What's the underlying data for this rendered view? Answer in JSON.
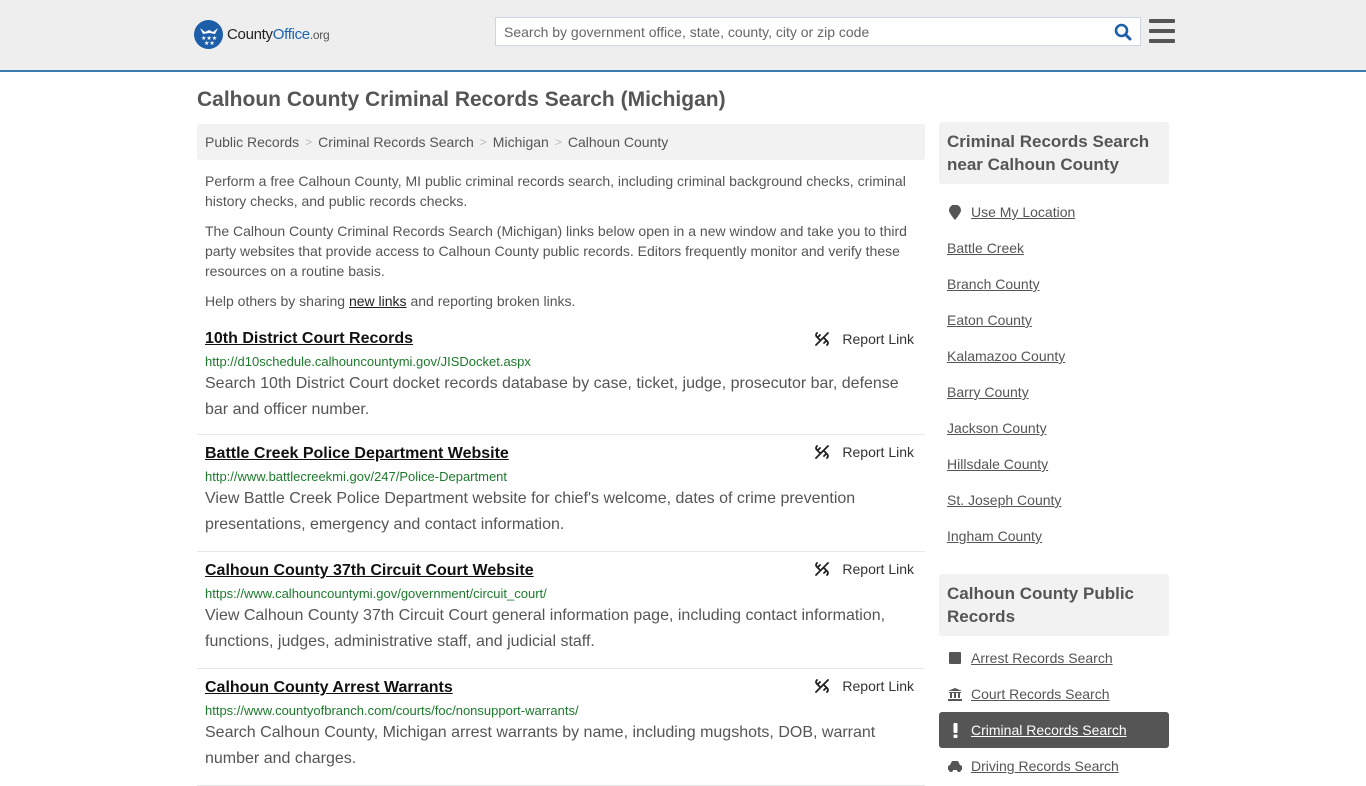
{
  "header": {
    "logo": {
      "county": "County",
      "office": "Office",
      "org": ".org"
    },
    "search": {
      "placeholder": "Search by government office, state, county, city or zip code",
      "value": ""
    },
    "search_icon": "search-icon",
    "menu_icon": "hamburger-menu-icon"
  },
  "page": {
    "title": "Calhoun County Criminal Records Search (Michigan)",
    "breadcrumb": [
      "Public Records",
      "Criminal Records Search",
      "Michigan",
      "Calhoun County"
    ],
    "breadcrumb_separator": ">",
    "intro": {
      "p1": "Perform a free Calhoun County, MI public criminal records search, including criminal background checks, criminal history checks, and public records checks.",
      "p2": "The Calhoun County Criminal Records Search (Michigan) links below open in a new window and take you to third party websites that provide access to Calhoun County public records. Editors frequently monitor and verify these resources on a routine basis.",
      "p3_before": "Help others by sharing ",
      "p3_link": "new links",
      "p3_after": " and reporting broken links."
    },
    "report_label": "Report Link",
    "results": [
      {
        "title": "10th District Court Records",
        "url": "http://d10schedule.calhouncountymi.gov/JISDocket.aspx",
        "description": "Search 10th District Court docket records database by case, ticket, judge, prosecutor bar, defense bar and officer number."
      },
      {
        "title": "Battle Creek Police Department Website",
        "url": "http://www.battlecreekmi.gov/247/Police-Department",
        "description": "View Battle Creek Police Department website for chief's welcome, dates of crime prevention presentations, emergency and contact information."
      },
      {
        "title": "Calhoun County 37th Circuit Court Website",
        "url": "https://www.calhouncountymi.gov/government/circuit_court/",
        "description": "View Calhoun County 37th Circuit Court general information page, including contact information, functions, judges, administrative staff, and judicial staff."
      },
      {
        "title": "Calhoun County Arrest Warrants",
        "url": "https://www.countyofbranch.com/courts/foc/nonsupport-warrants/",
        "description": "Search Calhoun County, Michigan arrest warrants by name, including mugshots, DOB, warrant number and charges."
      }
    ]
  },
  "sidebar": {
    "nearby": {
      "heading": "Criminal Records Search near Calhoun County",
      "use_location": "Use My Location",
      "items": [
        "Battle Creek",
        "Branch County",
        "Eaton County",
        "Kalamazoo County",
        "Barry County",
        "Jackson County",
        "Hillsdale County",
        "St. Joseph County",
        "Ingham County"
      ]
    },
    "public_records": {
      "heading": "Calhoun County Public Records",
      "items": [
        {
          "label": "Arrest Records Search",
          "icon": "square-icon",
          "active": false
        },
        {
          "label": "Court Records Search",
          "icon": "courthouse-icon",
          "active": false
        },
        {
          "label": "Criminal Records Search",
          "icon": "exclamation-icon",
          "active": true
        },
        {
          "label": "Driving Records Search",
          "icon": "car-icon",
          "active": false
        }
      ]
    }
  },
  "colors": {
    "header_bg": "#eeeeee",
    "header_border": "#3a7cae",
    "brand_blue": "#1d63b0",
    "url_green": "#1d7a2c",
    "active_bg": "#555555"
  }
}
